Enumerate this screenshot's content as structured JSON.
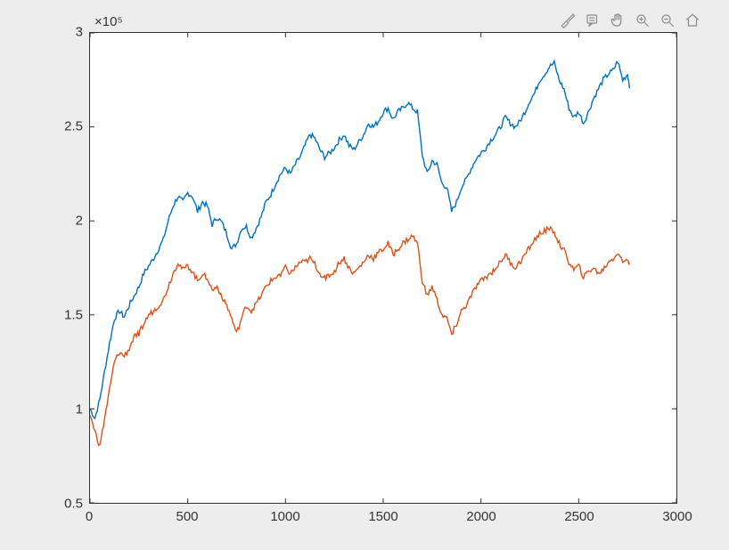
{
  "toolbar": {
    "items": [
      {
        "name": "brush-icon"
      },
      {
        "name": "datatip-icon"
      },
      {
        "name": "pan-icon"
      },
      {
        "name": "zoom-in-icon"
      },
      {
        "name": "zoom-out-icon"
      },
      {
        "name": "home-icon"
      }
    ]
  },
  "axes": {
    "exp_label": "×10⁵",
    "x_ticks": [
      "0",
      "500",
      "1000",
      "1500",
      "2000",
      "2500",
      "3000"
    ],
    "y_ticks": [
      "0.5",
      "1",
      "1.5",
      "2",
      "2.5",
      "3"
    ],
    "xlim": [
      0,
      3000
    ],
    "ylim": [
      0.5,
      3.0
    ]
  },
  "chart_data": {
    "type": "line",
    "title": "",
    "xlabel": "",
    "ylabel": "",
    "xlim": [
      0,
      3000
    ],
    "ylim": [
      50000,
      300000
    ],
    "y_scale_exponent": 5,
    "series": [
      {
        "name": "series-1",
        "color": "#0072BD",
        "x": [
          0,
          25,
          50,
          75,
          100,
          125,
          150,
          175,
          200,
          225,
          250,
          275,
          300,
          325,
          350,
          375,
          400,
          425,
          450,
          475,
          500,
          525,
          550,
          575,
          600,
          625,
          650,
          675,
          700,
          725,
          750,
          775,
          800,
          825,
          850,
          875,
          900,
          925,
          950,
          975,
          1000,
          1025,
          1050,
          1075,
          1100,
          1125,
          1150,
          1175,
          1200,
          1225,
          1250,
          1275,
          1300,
          1325,
          1350,
          1375,
          1400,
          1425,
          1450,
          1475,
          1500,
          1525,
          1550,
          1575,
          1600,
          1625,
          1650,
          1675,
          1700,
          1725,
          1750,
          1775,
          1800,
          1825,
          1850,
          1875,
          1900,
          1925,
          1950,
          1975,
          2000,
          2025,
          2050,
          2075,
          2100,
          2125,
          2150,
          2175,
          2200,
          2225,
          2250,
          2275,
          2300,
          2325,
          2350,
          2375,
          2400,
          2425,
          2450,
          2475,
          2500,
          2525,
          2550,
          2575,
          2600,
          2625,
          2650,
          2675,
          2700,
          2725,
          2750,
          2760
        ],
        "y": [
          100000,
          95000,
          105000,
          120000,
          135000,
          148000,
          152000,
          149000,
          155000,
          160000,
          165000,
          172000,
          176000,
          180000,
          185000,
          190000,
          200000,
          208000,
          213000,
          210000,
          215000,
          213000,
          205000,
          210000,
          208000,
          198000,
          202000,
          199000,
          193000,
          185000,
          188000,
          196000,
          197000,
          191000,
          196000,
          202000,
          210000,
          214000,
          220000,
          225000,
          228000,
          225000,
          230000,
          234000,
          240000,
          246000,
          244000,
          238000,
          234000,
          236000,
          239000,
          243000,
          246000,
          240000,
          238000,
          242000,
          246000,
          252000,
          250000,
          253000,
          258000,
          260000,
          254000,
          258000,
          260000,
          263000,
          260000,
          258000,
          235000,
          225000,
          232000,
          230000,
          220000,
          218000,
          205000,
          210000,
          218000,
          222000,
          228000,
          233000,
          236000,
          239000,
          243000,
          246000,
          250000,
          255000,
          252000,
          250000,
          253000,
          258000,
          264000,
          268000,
          275000,
          278000,
          282000,
          284000,
          275000,
          270000,
          260000,
          255000,
          258000,
          252000,
          258000,
          265000,
          270000,
          275000,
          278000,
          280000,
          285000,
          275000,
          278000,
          272000
        ]
      },
      {
        "name": "series-2",
        "color": "#D95319",
        "x": [
          0,
          25,
          50,
          75,
          100,
          125,
          150,
          175,
          200,
          225,
          250,
          275,
          300,
          325,
          350,
          375,
          400,
          425,
          450,
          475,
          500,
          525,
          550,
          575,
          600,
          625,
          650,
          675,
          700,
          725,
          750,
          775,
          800,
          825,
          850,
          875,
          900,
          925,
          950,
          975,
          1000,
          1025,
          1050,
          1075,
          1100,
          1125,
          1150,
          1175,
          1200,
          1225,
          1250,
          1275,
          1300,
          1325,
          1350,
          1375,
          1400,
          1425,
          1450,
          1475,
          1500,
          1525,
          1550,
          1575,
          1600,
          1625,
          1650,
          1675,
          1700,
          1725,
          1750,
          1775,
          1800,
          1825,
          1850,
          1875,
          1900,
          1925,
          1950,
          1975,
          2000,
          2025,
          2050,
          2075,
          2100,
          2125,
          2150,
          2175,
          2200,
          2225,
          2250,
          2275,
          2300,
          2325,
          2350,
          2375,
          2400,
          2425,
          2450,
          2475,
          2500,
          2525,
          2550,
          2575,
          2600,
          2625,
          2650,
          2675,
          2700,
          2725,
          2750,
          2760
        ],
        "y": [
          97000,
          88000,
          80000,
          95000,
          110000,
          125000,
          130000,
          128000,
          132000,
          138000,
          140000,
          145000,
          150000,
          152000,
          155000,
          158000,
          165000,
          172000,
          178000,
          174000,
          176000,
          173000,
          168000,
          172000,
          170000,
          163000,
          165000,
          160000,
          155000,
          148000,
          140000,
          148000,
          155000,
          152000,
          156000,
          160000,
          165000,
          168000,
          170000,
          172000,
          175000,
          172000,
          175000,
          178000,
          178000,
          180000,
          177000,
          172000,
          170000,
          171000,
          173000,
          178000,
          180000,
          175000,
          172000,
          175000,
          178000,
          182000,
          180000,
          183000,
          185000,
          188000,
          182000,
          185000,
          188000,
          190000,
          192000,
          188000,
          168000,
          160000,
          165000,
          158000,
          150000,
          148000,
          140000,
          145000,
          152000,
          155000,
          160000,
          165000,
          168000,
          170000,
          172000,
          175000,
          178000,
          182000,
          178000,
          175000,
          178000,
          182000,
          186000,
          190000,
          193000,
          195000,
          196000,
          194000,
          188000,
          184000,
          178000,
          174000,
          176000,
          170000,
          173000,
          175000,
          172000,
          174000,
          178000,
          180000,
          183000,
          178000,
          180000,
          178000
        ]
      }
    ]
  }
}
